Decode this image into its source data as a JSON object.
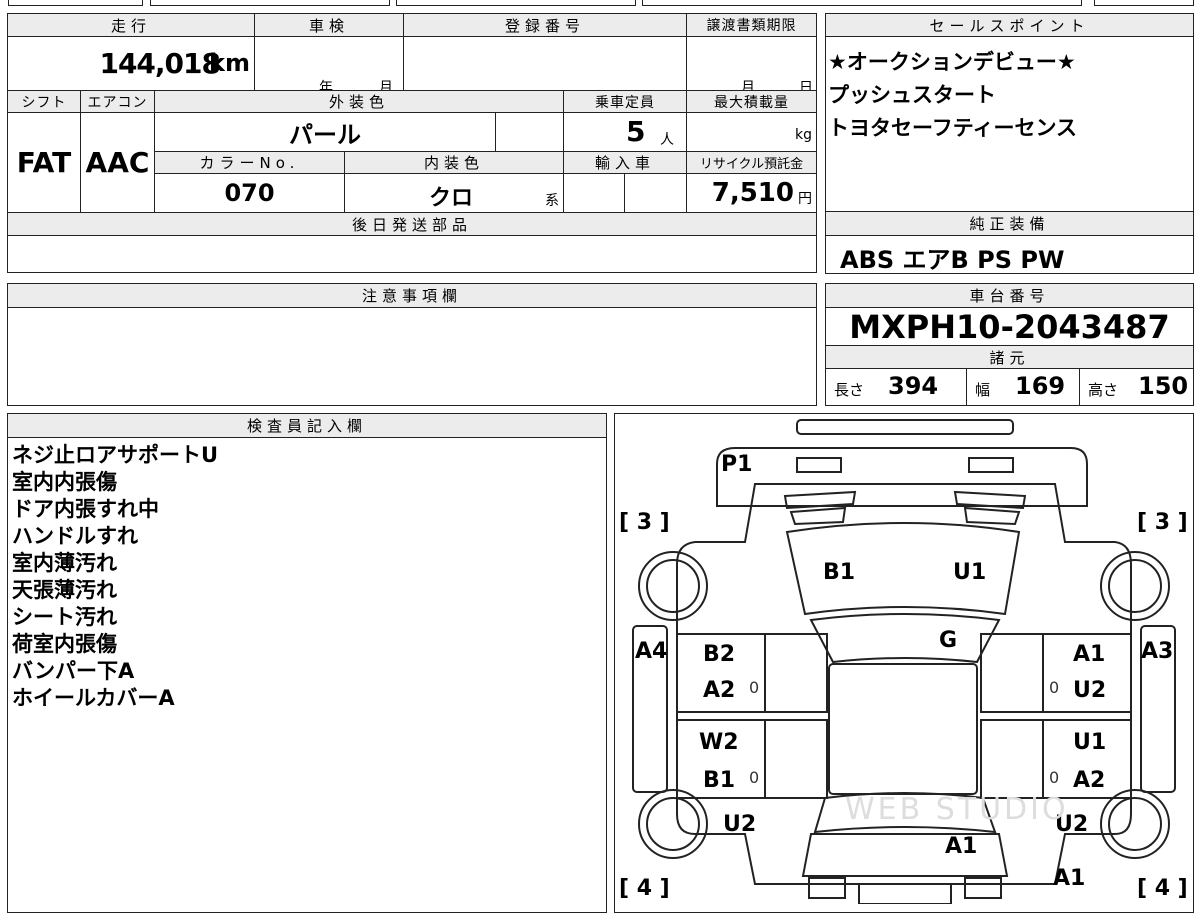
{
  "vehicle": {
    "mileage_label": "走行",
    "mileage_value": "144,018",
    "mileage_unit": "km",
    "inspection_label": "車検",
    "inspection_year": "年",
    "inspection_month": "月",
    "registration_label": "登録番号",
    "registration_value": "",
    "transfer_label": "譲渡書類期限",
    "transfer_month": "月",
    "transfer_day": "日",
    "shift_label": "シフト",
    "shift_value": "FAT",
    "ac_label": "エアコン",
    "ac_value": "AAC",
    "exterior_label": "外装色",
    "exterior_value": "パール",
    "capacity_label": "乗車定員",
    "capacity_value": "5",
    "capacity_unit": "人",
    "load_label": "最大積載量",
    "load_unit": "kg",
    "color_no_label": "カラーNo.",
    "color_no_value": "070",
    "interior_label": "内装色",
    "interior_value": "クロ",
    "interior_suffix": "系",
    "import_label": "輸入車",
    "recycle_label": "リサイクル預託金",
    "recycle_value": "7,510",
    "recycle_unit": "円",
    "later_parts_label": "後日発送部品"
  },
  "sales_points": {
    "label": "セールスポイント",
    "items": [
      "★オークションデビュー★",
      "プッシュスタート",
      "トヨタセーフティーセンス"
    ]
  },
  "genuine_equipment": {
    "label": "純正装備",
    "value": "ABS エアB PS PW"
  },
  "notes": {
    "label": "注意事項欄"
  },
  "chassis": {
    "label": "車台番号",
    "value": "MXPH10-2043487"
  },
  "specs": {
    "label": "諸元",
    "length_label": "長さ",
    "length_value": "394",
    "width_label": "幅",
    "width_value": "169",
    "height_label": "高さ",
    "height_value": "150"
  },
  "inspector": {
    "label": "検査員記入欄",
    "lines": [
      "ネジ止ロアサポートU",
      "室内内張傷",
      "ドア内張すれ中",
      "ハンドルすれ",
      "室内薄汚れ",
      "天張薄汚れ",
      "シート汚れ",
      "荷室内張傷",
      "バンパー下A",
      "ホイールカバーA"
    ]
  },
  "diagram": {
    "p1": "P1",
    "front_left": "[ 3 ]",
    "front_right": "[ 3 ]",
    "rear_left": "[ 4 ]",
    "rear_right": "[ 4 ]",
    "hood": [
      "B1",
      "U1"
    ],
    "windshield": "G",
    "left_side": "A4",
    "right_side": "A3",
    "left_front_door": [
      "B2",
      "A2"
    ],
    "right_front_door": [
      "A1",
      "U2"
    ],
    "left_rear_door": [
      "W2",
      "B1"
    ],
    "right_rear_door": [
      "U1",
      "A2"
    ],
    "left_rear_wheel": "U2",
    "right_rear_wheel": "U2",
    "trunk": "A1",
    "rear_bumper": "A1",
    "zero": "0",
    "watermark": "WEB STUDIO"
  }
}
